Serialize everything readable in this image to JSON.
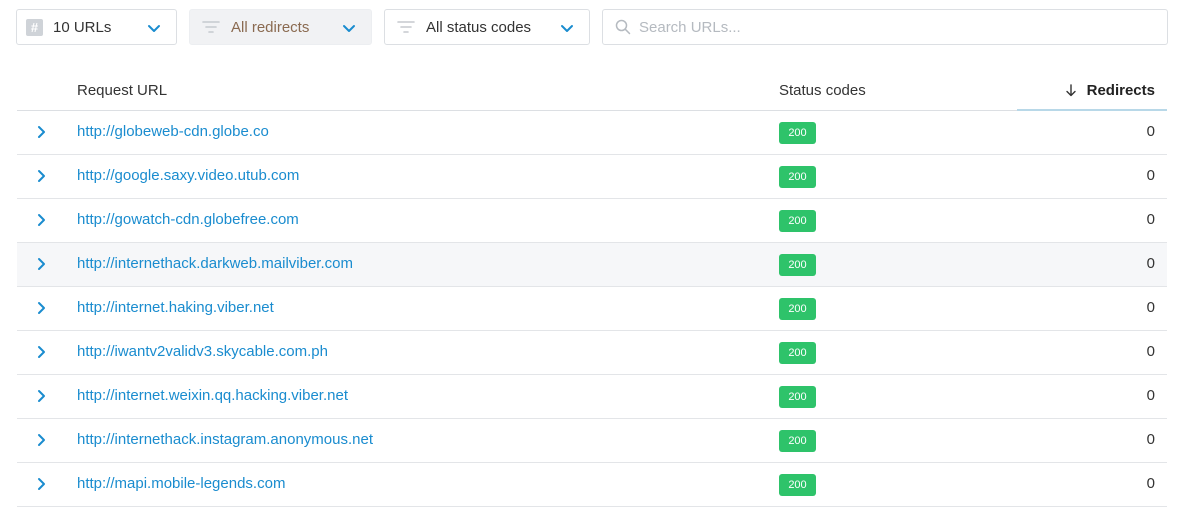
{
  "toolbar": {
    "url_count": "10 URLs",
    "redirect_filter": "All redirects",
    "status_filter": "All status codes",
    "search_placeholder": "Search URLs..."
  },
  "table": {
    "columns": {
      "url": "Request URL",
      "status": "Status codes",
      "redirects": "Redirects"
    },
    "sort": {
      "column": "Redirects",
      "direction": "descending"
    },
    "rows": [
      {
        "url": "http://globeweb-cdn.globe.co",
        "status": "200",
        "redirects": "0"
      },
      {
        "url": "http://google.saxy.video.utub.com",
        "status": "200",
        "redirects": "0"
      },
      {
        "url": "http://gowatch-cdn.globefree.com",
        "status": "200",
        "redirects": "0"
      },
      {
        "url": "http://internethack.darkweb.mailviber.com",
        "status": "200",
        "redirects": "0"
      },
      {
        "url": "http://internet.haking.viber.net",
        "status": "200",
        "redirects": "0"
      },
      {
        "url": "http://iwantv2validv3.skycable.com.ph",
        "status": "200",
        "redirects": "0"
      },
      {
        "url": "http://internet.weixin.qq.hacking.viber.net",
        "status": "200",
        "redirects": "0"
      },
      {
        "url": "http://internethack.instagram.anonymous.net",
        "status": "200",
        "redirects": "0"
      },
      {
        "url": "http://mapi.mobile-legends.com",
        "status": "200",
        "redirects": "0"
      }
    ]
  },
  "colors": {
    "link": "#1a8ccf",
    "status_ok": "#2ec36a",
    "accent": "#1a8ccf"
  },
  "icons": {
    "url_count": "hash-icon",
    "filter": "filter-icon",
    "dropdown": "chevron-down-icon",
    "search": "search-icon",
    "expand": "chevron-right-icon",
    "sort": "arrow-down-icon"
  }
}
